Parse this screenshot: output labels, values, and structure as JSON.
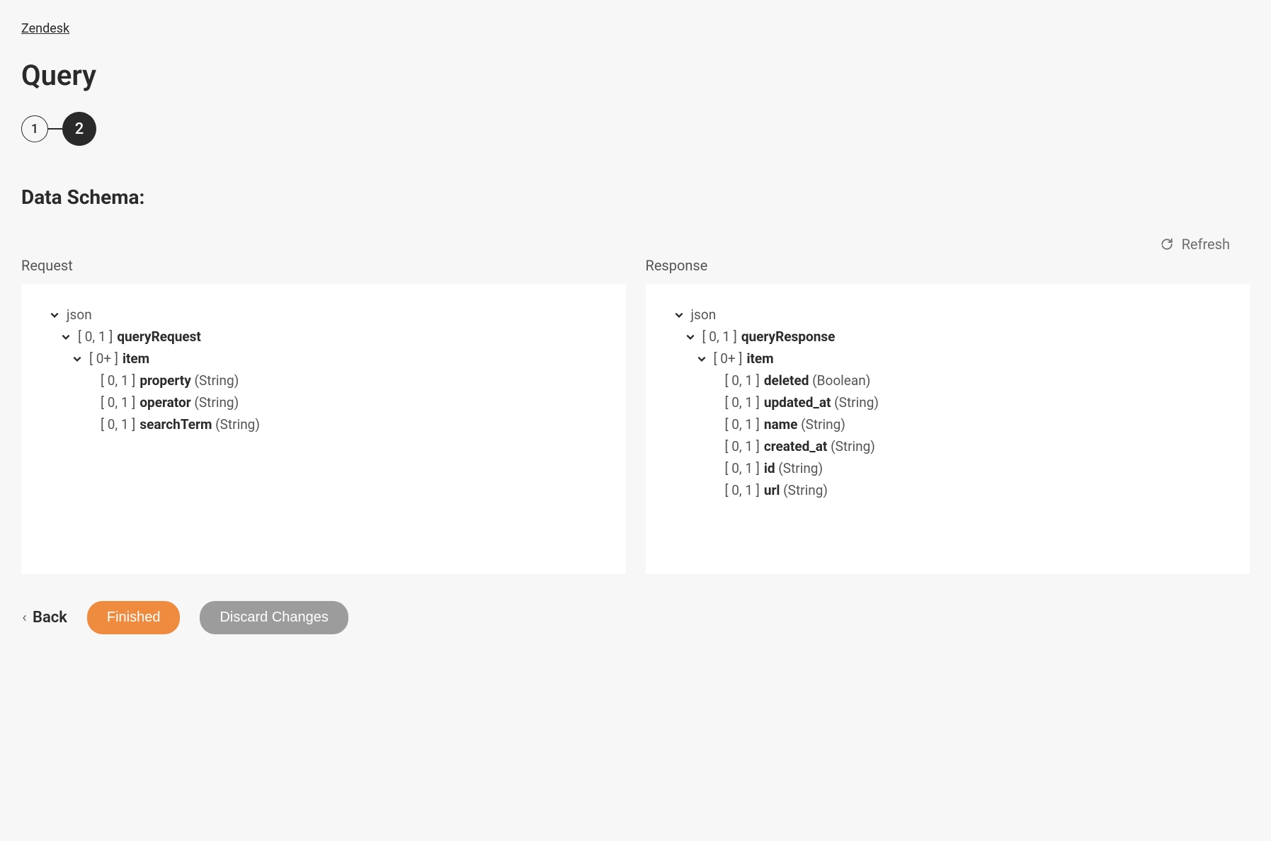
{
  "breadcrumb": "Zendesk",
  "page_title": "Query",
  "stepper": {
    "step1": "1",
    "step2": "2"
  },
  "schema_heading": "Data Schema:",
  "refresh_label": "Refresh",
  "panels": {
    "request": {
      "label": "Request",
      "root": "json",
      "tree": [
        {
          "indent": 1,
          "chevron": true,
          "card": "[ 0, 1 ]",
          "name": "queryRequest",
          "type": ""
        },
        {
          "indent": 2,
          "chevron": true,
          "card": "[ 0+ ]",
          "name": "item",
          "type": ""
        },
        {
          "indent": 3,
          "chevron": false,
          "card": "[ 0, 1 ]",
          "name": "property",
          "type": "(String)"
        },
        {
          "indent": 3,
          "chevron": false,
          "card": "[ 0, 1 ]",
          "name": "operator",
          "type": "(String)"
        },
        {
          "indent": 3,
          "chevron": false,
          "card": "[ 0, 1 ]",
          "name": "searchTerm",
          "type": "(String)"
        }
      ]
    },
    "response": {
      "label": "Response",
      "root": "json",
      "tree": [
        {
          "indent": 1,
          "chevron": true,
          "card": "[ 0, 1 ]",
          "name": "queryResponse",
          "type": ""
        },
        {
          "indent": 2,
          "chevron": true,
          "card": "[ 0+ ]",
          "name": "item",
          "type": ""
        },
        {
          "indent": 3,
          "chevron": false,
          "card": "[ 0, 1 ]",
          "name": "deleted",
          "type": "(Boolean)"
        },
        {
          "indent": 3,
          "chevron": false,
          "card": "[ 0, 1 ]",
          "name": "updated_at",
          "type": "(String)"
        },
        {
          "indent": 3,
          "chevron": false,
          "card": "[ 0, 1 ]",
          "name": "name",
          "type": "(String)"
        },
        {
          "indent": 3,
          "chevron": false,
          "card": "[ 0, 1 ]",
          "name": "created_at",
          "type": "(String)"
        },
        {
          "indent": 3,
          "chevron": false,
          "card": "[ 0, 1 ]",
          "name": "id",
          "type": "(String)"
        },
        {
          "indent": 3,
          "chevron": false,
          "card": "[ 0, 1 ]",
          "name": "url",
          "type": "(String)"
        }
      ]
    }
  },
  "actions": {
    "back": "Back",
    "finished": "Finished",
    "discard": "Discard Changes"
  }
}
